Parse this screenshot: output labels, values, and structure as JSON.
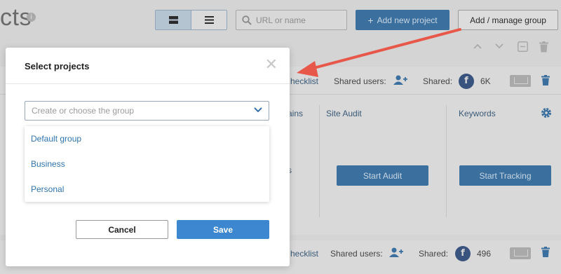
{
  "header": {
    "title_partial": "cts",
    "search_placeholder": "URL or name",
    "add_project_label": "Add new project",
    "add_group_label": "Add / manage group"
  },
  "project_rows": [
    {
      "checklist_label": "hecklist",
      "shared_users_label": "Shared users:",
      "shared_label": "Shared:",
      "shared_count": "6K",
      "columns": [
        {
          "title": "ains"
        },
        {
          "title": "Site Audit",
          "button": "Start Audit"
        },
        {
          "title": "Keywords",
          "button": "Start Tracking"
        }
      ],
      "partial_text": "s"
    },
    {
      "checklist_label": "hecklist",
      "shared_users_label": "Shared users:",
      "shared_label": "Shared:",
      "shared_count": "496"
    }
  ],
  "modal": {
    "title": "Select projects",
    "select_placeholder": "Create or choose the group",
    "options": [
      "Default group",
      "Business",
      "Personal"
    ],
    "cancel_label": "Cancel",
    "save_label": "Save"
  },
  "colors": {
    "primary": "#3c87d0",
    "arrow": "#e8584a",
    "link": "#2f73ad"
  },
  "icons": [
    "info-icon",
    "grid-view-icon",
    "list-view-icon",
    "search-icon",
    "plus-icon",
    "chevron-up-icon",
    "chevron-down-icon",
    "collapse-icon",
    "trash-icon",
    "add-user-icon",
    "facebook-icon",
    "mail-icon",
    "gear-icon",
    "close-icon",
    "dropdown-chevron-icon"
  ]
}
